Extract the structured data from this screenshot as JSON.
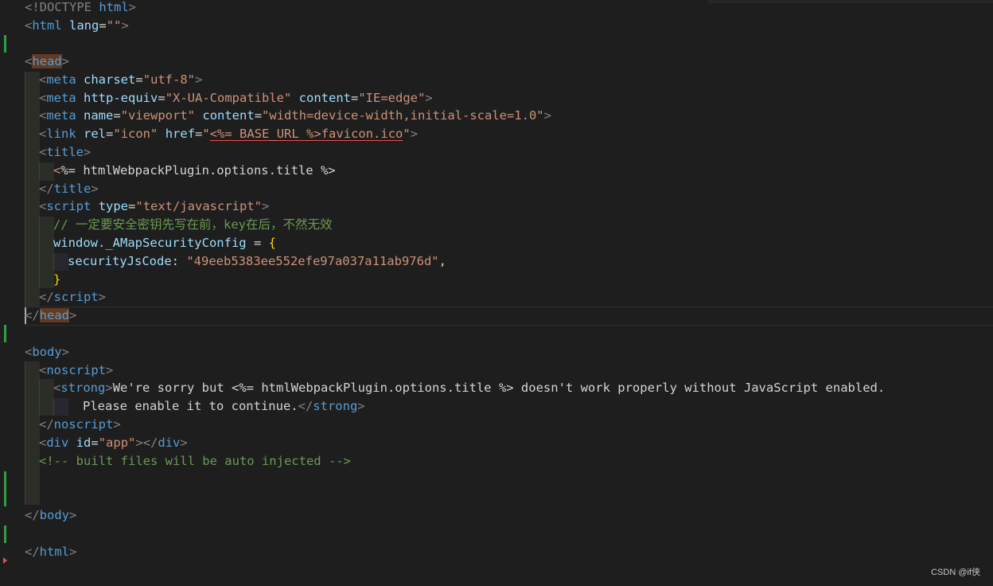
{
  "editor": {
    "language": "html",
    "lines": {
      "doctype": {
        "open": "<!DOCTYPE ",
        "keyword": "html",
        "close": ">"
      },
      "html_open": {
        "open": "<",
        "tag": "html",
        "attr": "lang",
        "eq": "=",
        "val": "\"\"",
        "close": ">"
      },
      "head_open": {
        "open": "<",
        "tag": "head",
        "close": ">"
      },
      "meta_charset": {
        "open": "<",
        "tag": "meta",
        "attr": "charset",
        "eq": "=",
        "val": "\"utf-8\"",
        "close": ">"
      },
      "meta_http": {
        "open": "<",
        "tag": "meta",
        "attr1": "http-equiv",
        "eq": "=",
        "val1": "\"X-UA-Compatible\"",
        "attr2": "content",
        "val2": "\"IE=edge\"",
        "close": ">"
      },
      "meta_viewport": {
        "open": "<",
        "tag": "meta",
        "attr1": "name",
        "eq": "=",
        "val1": "\"viewport\"",
        "attr2": "content",
        "val2": "\"width=device-width,initial-scale=1.0\"",
        "close": ">"
      },
      "link_icon": {
        "open": "<",
        "tag": "link",
        "attr1": "rel",
        "eq": "=",
        "val1": "\"icon\"",
        "attr2": "href",
        "val2_open": "\"",
        "val2_ejs": "<%= BASE_URL %>",
        "val2_file": "favicon.ico",
        "val2_close": "\"",
        "close": ">"
      },
      "title_open": {
        "open": "<",
        "tag": "title",
        "close": ">"
      },
      "title_content": {
        "ejs_open": "<",
        "rest": "%= htmlWebpackPlugin.options.title %>"
      },
      "title_close": {
        "open": "</",
        "tag": "title",
        "close": ">"
      },
      "script_open": {
        "open": "<",
        "tag": "script",
        "attr": "type",
        "eq": "=",
        "val": "\"text/javascript\"",
        "close": ">"
      },
      "js_comment": "// 一定要安全密钥先写在前，key在后，不然无效",
      "js_window": {
        "obj": "window._AMapSecurityConfig",
        "op": " = ",
        "brace": "{"
      },
      "js_code": {
        "key": "securityJsCode",
        "colon": ": ",
        "value": "\"49eeb5383ee552efe97a037a11ab976d\"",
        "comma": ","
      },
      "js_close": "}",
      "script_close": {
        "open": "</",
        "tag": "script",
        "close": ">"
      },
      "head_close": {
        "open": "</",
        "tag": "head",
        "close": ">"
      },
      "body_open": {
        "open": "<",
        "tag": "body",
        "close": ">"
      },
      "noscript_open": {
        "open": "<",
        "tag": "noscript",
        "close": ">"
      },
      "strong_line": {
        "open": "<",
        "tag": "strong",
        "close": ">",
        "text": "We're sorry but <%= htmlWebpackPlugin.options.title %> doesn't work properly without JavaScript enabled."
      },
      "strong_cont": {
        "text": "Please enable it to continue.",
        "open": "</",
        "tag": "strong",
        "close": ">"
      },
      "noscript_close": {
        "open": "</",
        "tag": "noscript",
        "close": ">"
      },
      "div_app": {
        "open": "<",
        "tag": "div",
        "attr": "id",
        "eq": "=",
        "val": "\"app\"",
        "mid": "></",
        "tag2": "div",
        "close": ">"
      },
      "html_comment": "<!-- built files will be auto injected -->",
      "body_close": {
        "open": "</",
        "tag": "body",
        "close": ">"
      },
      "html_close": {
        "open": "</",
        "tag": "html",
        "close": ">"
      }
    }
  },
  "watermark": "CSDN @if侠",
  "colors": {
    "background": "#1e1e1e",
    "tag": "#569cd6",
    "attribute": "#9cdcfe",
    "string": "#ce9178",
    "comment": "#6a9955",
    "bracket": "#808080",
    "gutter_modified": "#2ea043"
  }
}
